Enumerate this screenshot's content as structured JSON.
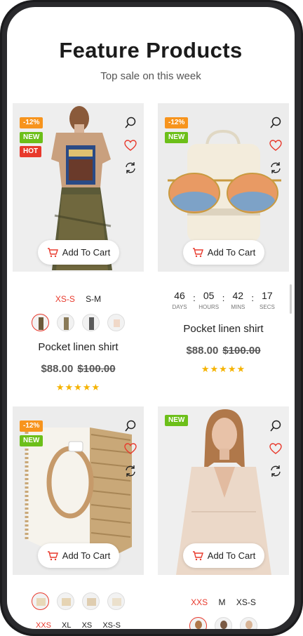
{
  "section": {
    "title": "Feature Products",
    "subtitle": "Top sale on this week"
  },
  "cart_label": "Add To Cart",
  "colors": {
    "accent": "#e8392c",
    "sale": "#f7941d",
    "new": "#6cbf19",
    "hot": "#e8392c",
    "star": "#f5b301"
  },
  "products": [
    {
      "badges": [
        "-12%",
        "NEW",
        "HOT"
      ],
      "sizes": [
        "XS-S",
        "S-M"
      ],
      "name": "Pocket linen shirt",
      "price": "$88.00",
      "old_price": "$100.00",
      "rating": "★★★★★"
    },
    {
      "badges": [
        "-12%",
        "NEW"
      ],
      "countdown": {
        "days": "46",
        "hours": "05",
        "mins": "42",
        "secs": "17",
        "labels": [
          "DAYS",
          "HOURS",
          "MINS",
          "SECS"
        ]
      },
      "name": "Pocket linen shirt",
      "price": "$88.00",
      "old_price": "$100.00",
      "rating": "★★★★★"
    },
    {
      "badges": [
        "-12%",
        "NEW"
      ],
      "sizes": [
        "XXS",
        "XL",
        "XS",
        "XS-S"
      ]
    },
    {
      "badges": [
        "NEW"
      ],
      "sizes": [
        "XXS",
        "M",
        "XS-S"
      ]
    }
  ],
  "icons": [
    "search-icon",
    "heart-icon",
    "compare-icon",
    "cart-icon"
  ]
}
